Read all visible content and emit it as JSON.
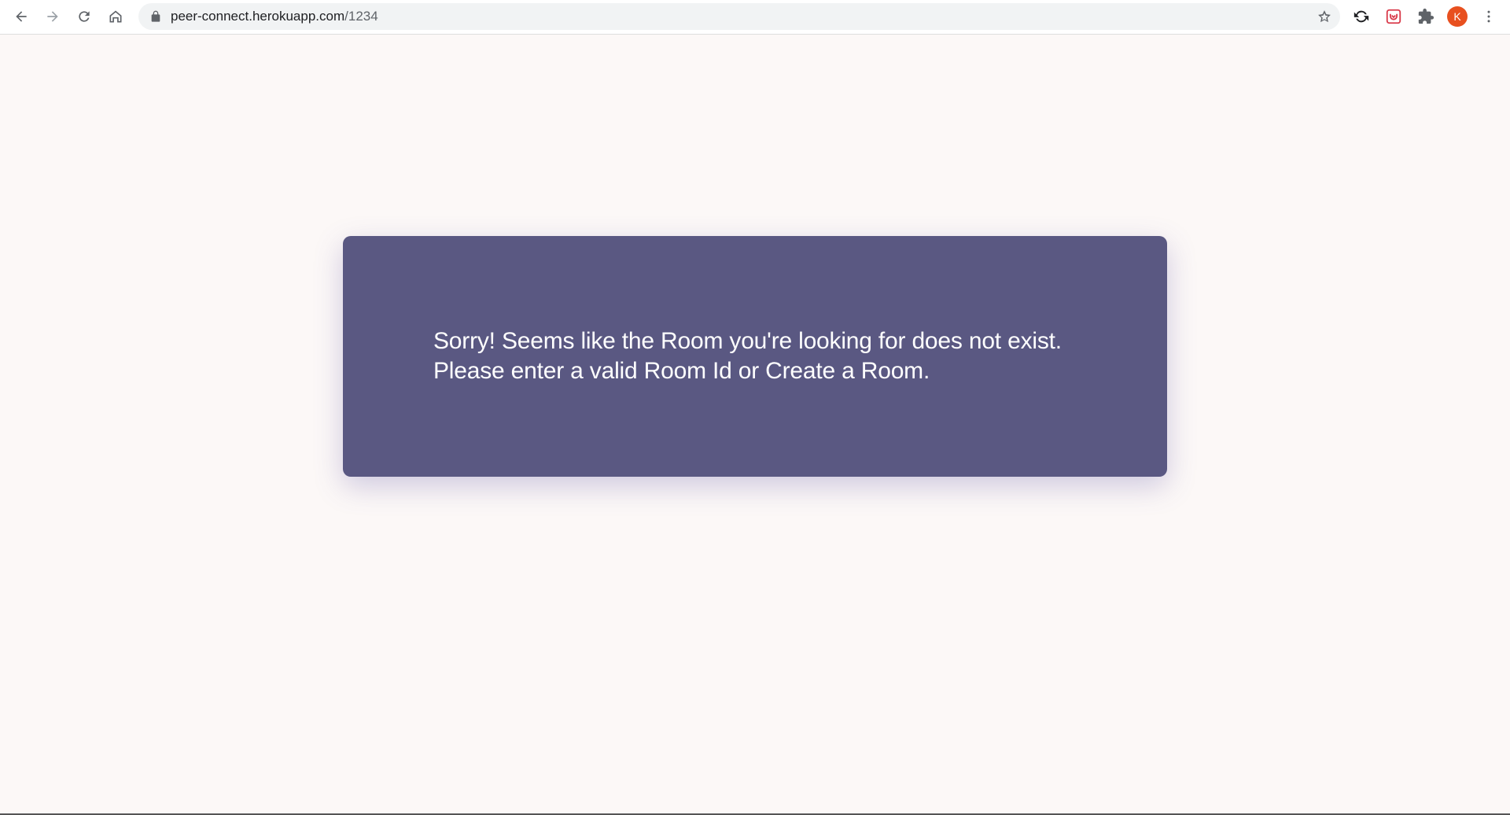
{
  "browser": {
    "url_host": "peer-connect.herokuapp.com",
    "url_path": "/1234",
    "nav_icons": [
      "back-icon",
      "forward-icon",
      "reload-icon",
      "home-icon"
    ],
    "extension_icons": [
      "sync-extension-icon",
      "pocket-extension-icon",
      "puzzle-extensions-icon"
    ],
    "profile_initial": "K",
    "profile_color": "#e8501f"
  },
  "page": {
    "message_line1": "Sorry! Seems like the Room you're looking for does not exist.",
    "message_line2": "Please enter a valid Room Id or Create a Room.",
    "card_color": "#5a5882",
    "background_color": "#fcf8f7"
  }
}
